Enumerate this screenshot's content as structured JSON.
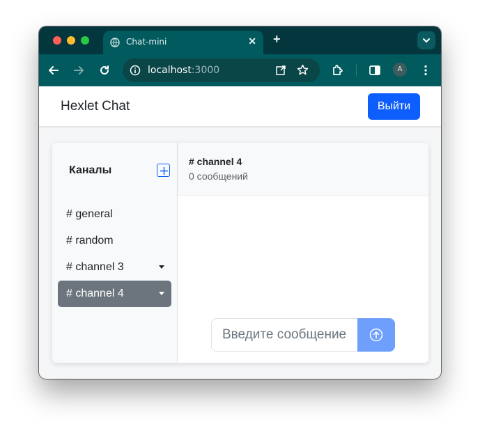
{
  "browser": {
    "tab_title": "Chat-mini",
    "url_host": "localhost",
    "url_port": ":3000",
    "profile_initial": "A"
  },
  "navbar": {
    "brand": "Hexlet Chat",
    "logout_label": "Выйти"
  },
  "sidebar": {
    "title": "Каналы",
    "channels": [
      {
        "label": "# general",
        "has_menu": false,
        "active": false
      },
      {
        "label": "# random",
        "has_menu": false,
        "active": false
      },
      {
        "label": "# channel 3",
        "has_menu": true,
        "active": false
      },
      {
        "label": "# channel 4",
        "has_menu": true,
        "active": true
      }
    ]
  },
  "chat": {
    "channel_name": "# channel 4",
    "message_count": "0 сообщений",
    "input_placeholder": "Введите сообщение...",
    "input_value": ""
  },
  "colors": {
    "primary": "#0d5efd",
    "active_channel": "#6c757d",
    "browser_frame": "#015a5e"
  }
}
